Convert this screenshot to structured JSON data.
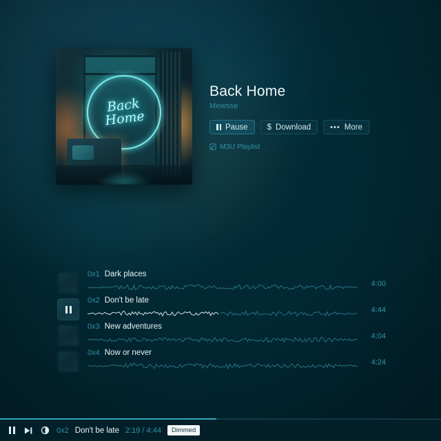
{
  "colors": {
    "background": "#022934",
    "accent": "#2f96a6",
    "text": "#e6f3f5",
    "badge_bg": "#f3f7f8",
    "progress": "#34a7b6"
  },
  "hero": {
    "cover_alt": "album-cover-back-home",
    "cover_neon_line1": "Back",
    "cover_neon_line2": "Home",
    "title": "Back Home",
    "artist": "Mewsse",
    "buttons": [
      {
        "name": "pause-button",
        "label": "Pause",
        "icon": "pause-icon",
        "primary": true
      },
      {
        "name": "download-button",
        "label": "Download",
        "icon": "dollar-icon",
        "primary": false
      },
      {
        "name": "more-button",
        "label": "More",
        "icon": "ellipsis-icon",
        "primary": false
      }
    ],
    "playlist_link": {
      "label": "M3U Playlist",
      "icon": "playlist-icon"
    }
  },
  "tracks": [
    {
      "num": "0x1",
      "name": "Dark places",
      "duration": "4:00",
      "playing": false,
      "progress": 0
    },
    {
      "num": "0x2",
      "name": "Don't be late",
      "duration": "4:44",
      "playing": true,
      "progress": 49
    },
    {
      "num": "0x3",
      "name": "New adventures",
      "duration": "4:04",
      "playing": false,
      "progress": 0
    },
    {
      "num": "0x4",
      "name": "Now or never",
      "duration": "4:24",
      "playing": false,
      "progress": 0
    }
  ],
  "player": {
    "progress_percent": 49,
    "pause_label": "pause-icon",
    "next_label": "next-track-icon",
    "dim_label": "moon-icon",
    "track_num": "0x2",
    "track_name": "Don't be late",
    "time": "2:19 / 4:44",
    "dimmed_badge": "Dimmed"
  }
}
